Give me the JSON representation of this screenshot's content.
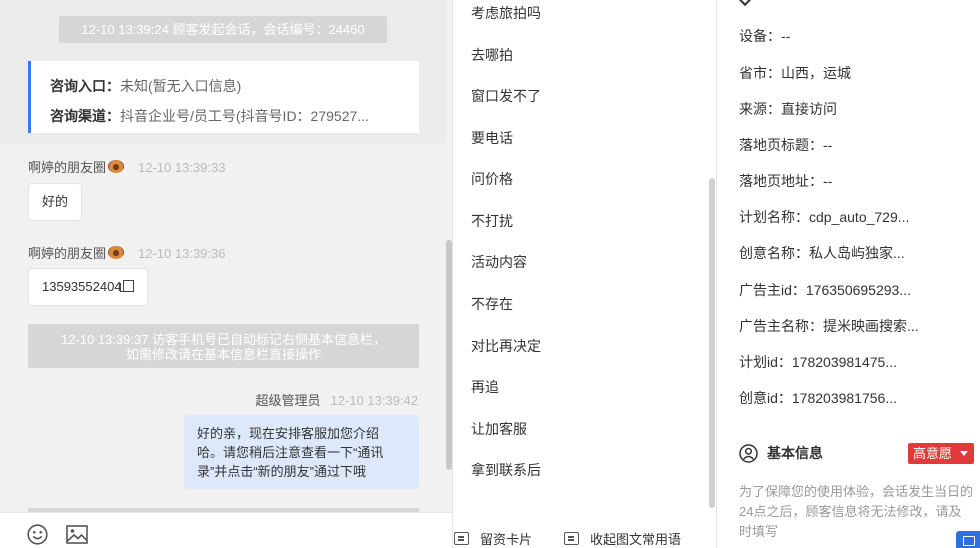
{
  "chat": {
    "session_start": "12-10 13:39:24 顾客发起会话，会话编号：24460",
    "entry": {
      "entry_label": "咨询入口：",
      "entry_value": "未知(暂无入口信息)",
      "channel_label": "咨询渠道：",
      "channel_value": "抖音企业号/员工号(抖音号ID：279527..."
    },
    "messages": [
      {
        "sender": "啊婷的朋友圈",
        "time": "12-10 13:39:33",
        "text": "好的"
      },
      {
        "sender": "啊婷的朋友圈",
        "time": "12-10 13:39:36",
        "text": "13593552404"
      }
    ],
    "system_notice_line1": "12-10 13:39:37 访客手机号已自动标记右侧基本信息栏，",
    "system_notice_line2": "如需修改请在基本信息栏直接操作",
    "admin": {
      "name": "超级管理员",
      "time": "12-10 13:39:42",
      "line1": "好的亲，现在安排客服加您介绍",
      "line2": "哈。请您稍后注意查看一下“通讯",
      "line3": "录”并点击“新的朋友”通过下哦"
    },
    "composer_icons": [
      "smile-icon",
      "image-icon"
    ]
  },
  "phrases": {
    "items": [
      "考虑旅拍吗",
      "去哪拍",
      "窗口发不了",
      "要电话",
      "问价格",
      "不打扰",
      "活动内容",
      "不存在",
      "对比再决定",
      "再追",
      "让加客服",
      "拿到联系后"
    ],
    "card_button": "留资卡片",
    "collapse_button": "收起图文常用语"
  },
  "info": {
    "fields": [
      "设备：--",
      "省市：山西，运城",
      "来源：直接访问",
      "落地页标题：--",
      "落地页地址：--",
      "计划名称：cdp_auto_729...",
      "创意名称：私人岛屿独家...",
      "广告主id：176350695293...",
      "广告主名称：提米映画搜索...",
      "计划id：178203981475...",
      "创意id：178203981756..."
    ],
    "section_title": "基本信息",
    "intent_badge": "高意愿",
    "notice": "为了保障您的使用体验，会话发生当日的24点之后，顾客信息将无法修改，请及时填写",
    "accent": "#3a7cf0",
    "badge_color": "#e23a3a"
  }
}
